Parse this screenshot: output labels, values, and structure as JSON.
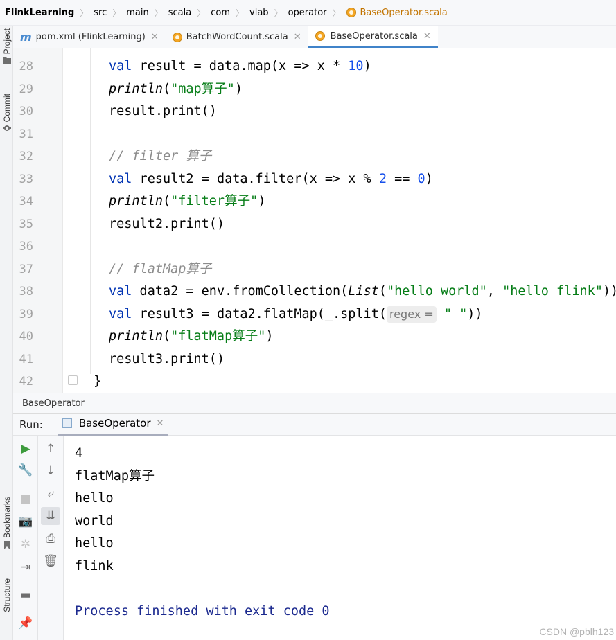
{
  "breadcrumb": {
    "items": [
      "FlinkLearning",
      "src",
      "main",
      "scala",
      "com",
      "vlab",
      "operator",
      "BaseOperator.scala"
    ]
  },
  "left_stripe": {
    "project": "Project",
    "commit": "Commit",
    "bookmarks": "Bookmarks",
    "structure": "Structure"
  },
  "tabs": [
    {
      "label": "pom.xml (FlinkLearning)",
      "icon": "maven-icon"
    },
    {
      "label": "BatchWordCount.scala",
      "icon": "scala-object-icon"
    },
    {
      "label": "BaseOperator.scala",
      "icon": "scala-object-icon",
      "active": true
    }
  ],
  "editor": {
    "line_numbers": [
      "28",
      "29",
      "30",
      "31",
      "32",
      "33",
      "34",
      "35",
      "36",
      "37",
      "38",
      "39",
      "40",
      "41",
      "42"
    ],
    "code": {
      "l28": {
        "kw": "val",
        "a": " result = data.map(x => x * ",
        "num": "10",
        "b": ")"
      },
      "l29": {
        "fn": "println",
        "a": "(",
        "str": "\"map算子\"",
        "b": ")"
      },
      "l30": {
        "a": "result.print()"
      },
      "l32": {
        "cmt": "// filter 算子"
      },
      "l33": {
        "kw": "val",
        "a": " result2 = data.filter(x => x % ",
        "num1": "2",
        "b": " == ",
        "num2": "0",
        "c": ")"
      },
      "l34": {
        "fn": "println",
        "a": "(",
        "str": "\"filter算子\"",
        "b": ")"
      },
      "l35": {
        "a": "result2.print()"
      },
      "l37": {
        "cmt": "// flatMap算子"
      },
      "l38": {
        "kw": "val",
        "a": " data2 = env.fromCollection(",
        "list": "List",
        "b": "(",
        "str1": "\"hello world\"",
        "c": ", ",
        "str2": "\"hello flink\"",
        "d": "))"
      },
      "l39": {
        "kw": "val",
        "a": " result3 = data2.flatMap(_.split(",
        "hint": "regex =",
        "str": "\" \"",
        "b": "))"
      },
      "l40": {
        "fn": "println",
        "a": "(",
        "str": "\"flatMap算子\"",
        "b": ")"
      },
      "l41": {
        "a": "result3.print()"
      },
      "l42": {
        "a": "}"
      }
    }
  },
  "editor_breadcrumb": "BaseOperator",
  "run": {
    "label": "Run:",
    "tab": "BaseOperator",
    "output": [
      "4",
      "flatMap算子",
      "hello",
      "world",
      "hello",
      "flink",
      "",
      "Process finished with exit code 0"
    ]
  },
  "watermark": "CSDN @pblh123",
  "colors": {
    "keyword": "#0033b3",
    "string": "#067d17",
    "number": "#1750eb",
    "comment": "#8c8c8c",
    "active_tab_underline": "#4083c9"
  }
}
